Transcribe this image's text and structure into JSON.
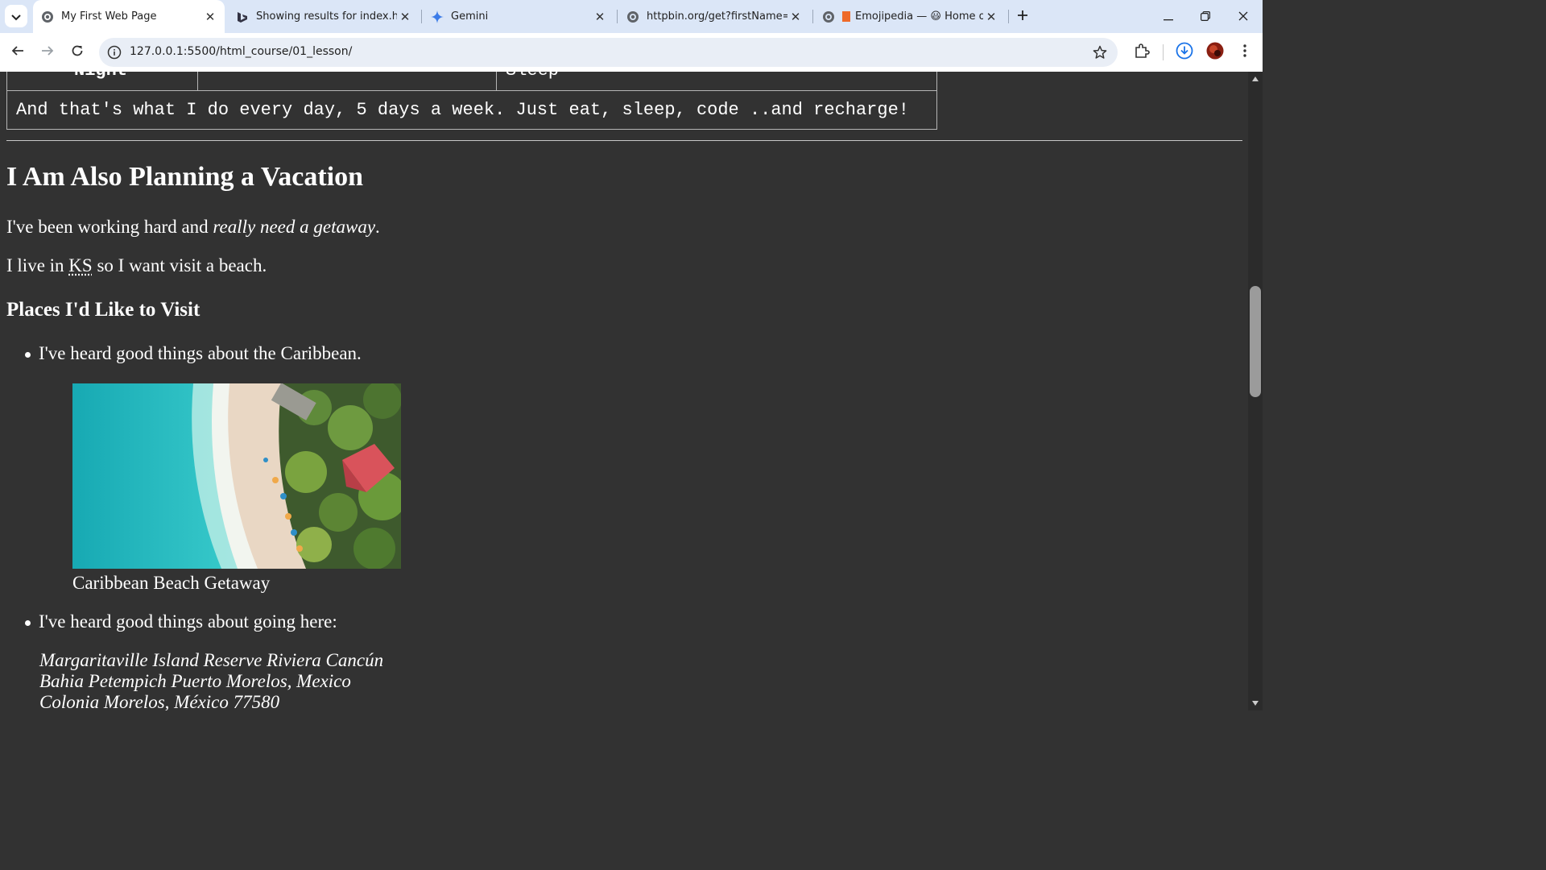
{
  "browser": {
    "tabs": [
      {
        "title": "My First Web Page",
        "active": true,
        "favicon": "globe-icon"
      },
      {
        "title": "Showing results for index.html",
        "active": false,
        "favicon": "bing-icon"
      },
      {
        "title": "Gemini",
        "active": false,
        "favicon": "gemini-sparkle-icon"
      },
      {
        "title": "httpbin.org/get?firstName=b&l",
        "active": false,
        "favicon": "globe-icon"
      },
      {
        "title": "Emojipedia — 😃 Home of",
        "active": false,
        "favicon": "emojipedia-icon"
      }
    ],
    "url": "127.0.0.1:5500/html_course/01_lesson/"
  },
  "page": {
    "table": {
      "partial_row_label": "Night",
      "partial_row_value": "Sleep",
      "footer": "And that's what I do every day, 5 days a week. Just eat, sleep, code ..and recharge!"
    },
    "vacation_heading": "I Am Also Planning a Vacation",
    "para1_start": "I've been working hard and ",
    "para1_em": "really need a getaway",
    "para1_end": ".",
    "para2_start": "I live in ",
    "para2_abbr": "KS",
    "para2_end": " so I want visit a beach.",
    "places_heading": "Places I'd Like to Visit",
    "places": [
      {
        "text": "I've heard good things about the Caribbean.",
        "caption": "Caribbean Beach Getaway"
      },
      {
        "text": "I've heard good things about going here:"
      }
    ],
    "address": [
      "Margaritaville Island Reserve Riviera Cancún",
      "Bahia Petempich Puerto Morelos, Mexico",
      "Colonia Morelos, México 77580"
    ]
  },
  "colors": {
    "page_bg": "#323232",
    "tabstrip_bg": "#dbe6f7",
    "omnibox_bg": "#e9eef6",
    "water": "#2ec4c8",
    "umbrella": "#d9535b"
  }
}
